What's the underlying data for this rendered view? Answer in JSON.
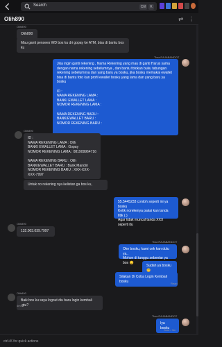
{
  "topbar": {
    "search_label": "Search",
    "ctrl_key": "Ctrl",
    "k_key": "K"
  },
  "chat": {
    "title": "Olih890"
  },
  "messages": {
    "m1": {
      "sender": "Olih890",
      "text": "Olih890"
    },
    "m2": {
      "text": "Mau ganti pensees WD bos ku dri gopay ke ATM, bisa di bantu bos ku"
    },
    "m3": {
      "sender": "Tiwa RAJABANDOT",
      "text": "Jika ingin ganti rekening , Nama Rekening yang mau di ganti Harus sama dengan nama rekening sebelumnya , dan bantu fotokan buku tabungan rekening sebelumnya dan yang baru ya bosku, jika bosku memakai ewallet bisa di bantu foto kan profil ewallet bosku yang lama dan yang baru ya bosku\n\nID :\nNAMA REKENING LAMA :\nBANK/ EWALLET LAMA :\nNOMOR REKENING LAMA :\n\nNAMA REKENING BARU :\nBANK/EWALLET BARU :\nNOMOR REKENING BARU :"
    },
    "m4": {
      "sender": "Olih890",
      "text": "ID :\nNAMA REKENING LAMA : Olih\nBANK/ EWALLET LAMA : Gopay\nNOMOR REKENING LAMA : 081909964716\n\nNAMA REKENING BARU : Olih\nBANK/EWALLET BARU : Bank Mandiri\nNOMOR REKENING BARU : XXX-XXX-XXX-7997"
    },
    "m5": {
      "text": "Untuk no rekening nya kelistan ga bos ku,"
    },
    "m6": {
      "text": "55.5445233 contoh seperti ini ya bosku\nKetik norekenya pakai kan tanda titik (.)\nAgar tidak muncul tanda XXX seperti itu"
    },
    "m7": {
      "sender": "Olih890",
      "text": "132.003.039.7997"
    },
    "m8": {
      "sender": "Tiwa RAJABANDOT",
      "text": "Oke bosku, kami cek kan dulu ya..\nMohon di tunggu sebentar ya bos 😊"
    },
    "m9": {
      "text": "Sudah ya bosku 😊"
    },
    "m10": {
      "text": "Silakan Di Coba Login Kembali bosku"
    },
    "m10_meta": "Read",
    "m11": {
      "sender": "Olih890",
      "text": "Baik bos ku saya logout diu baru login kembali ,gtu?"
    },
    "m11_meta": "4m",
    "m12": {
      "sender": "Tiwa RAJABANDOT",
      "text": "Iya bosku"
    },
    "m12_meta": "Sent • 3m"
  },
  "composer": {
    "hint": "ctrl+K for quick actions"
  }
}
